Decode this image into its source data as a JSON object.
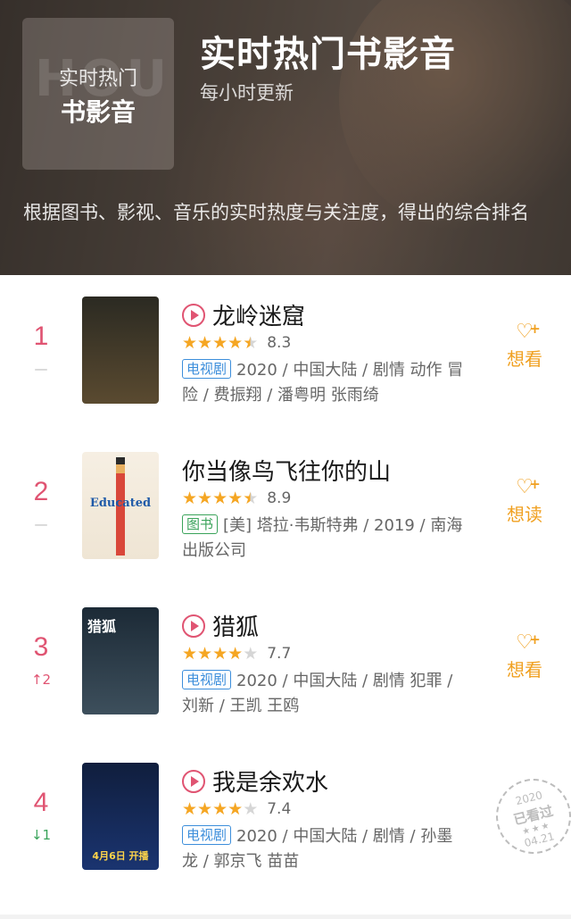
{
  "header": {
    "tile_line1": "实时热门",
    "tile_line2": "书影音",
    "tile_watermark": "HOUR",
    "title": "实时热门书影音",
    "subtitle": "每小时更新",
    "description": "根据图书、影视、音乐的实时热度与关注度，得出的综合排名"
  },
  "items": [
    {
      "rank": "1",
      "change": "—",
      "title": "龙岭迷窟",
      "has_play": true,
      "rating": 4.5,
      "score": "8.3",
      "tag": "电视剧",
      "tag_type": "tv",
      "meta": "2020 / 中国大陆 / 剧情 动作 冒险 / 费振翔 / 潘粤明 张雨绮",
      "action_label": "想看",
      "poster_colors": [
        "#2b2a22",
        "#5a4a30"
      ],
      "poster_text": ""
    },
    {
      "rank": "2",
      "change": "—",
      "title": "你当像鸟飞往你的山",
      "has_play": false,
      "rating": 4.5,
      "score": "8.9",
      "tag": "图书",
      "tag_type": "book",
      "meta": "[美] 塔拉·韦斯特弗 / 2019 / 南海出版公司",
      "action_label": "想读",
      "poster_colors": [
        "#f6efe3",
        "#efe5d4"
      ],
      "poster_text": "Educated"
    },
    {
      "rank": "3",
      "change": "↑2",
      "change_dir": "up",
      "title": "猎狐",
      "has_play": true,
      "rating": 4,
      "score": "7.7",
      "tag": "电视剧",
      "tag_type": "tv",
      "meta": "2020 / 中国大陆 / 剧情 犯罪 / 刘新 / 王凯 王鸥",
      "action_label": "想看",
      "poster_colors": [
        "#1c2a36",
        "#3d4f5c"
      ],
      "poster_text": "猎狐"
    },
    {
      "rank": "4",
      "change": "↓1",
      "change_dir": "down",
      "title": "我是余欢水",
      "has_play": true,
      "rating": 4,
      "score": "7.4",
      "tag": "电视剧",
      "tag_type": "tv",
      "meta": "2020 / 中国大陆 / 剧情 / 孙墨龙 / 郭京飞 苗苗",
      "action_label": "",
      "poster_colors": [
        "#101e3d",
        "#1a3470"
      ],
      "poster_text": "4月6日 开播",
      "stamp": {
        "year": "2020",
        "label": "已看过",
        "stars": "★★★",
        "date": "04.21"
      }
    }
  ]
}
